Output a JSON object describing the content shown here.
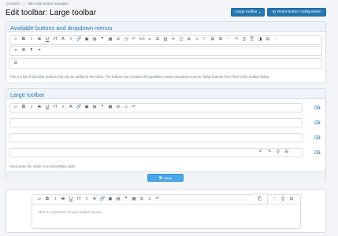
{
  "breadcrumb": {
    "items": [
      "Connect",
      "BB code button manager"
    ],
    "separator": ">"
  },
  "page": {
    "title": "Edit toolbar: Large toolbar"
  },
  "header_buttons": {
    "large_toolbar": "Large toolbar",
    "reset": "Reset button configuration"
  },
  "available": {
    "title": "Available buttons and dropdown menus",
    "row1_icons": [
      "smile-icon",
      "bold-icon",
      "italic-icon",
      "strikethrough-icon",
      "underline-icon",
      "font-size-icon",
      "color-icon",
      "text-style-icon",
      "link-icon",
      "image-icon",
      "media-icon",
      "quote-icon",
      "spoiler-icon",
      "emoji-icon",
      "undo-icon",
      "redo-icon",
      "code-icon",
      "align-icon",
      "list-icon",
      "table-icon",
      "inline-code-icon",
      "hide-icon",
      "more-icon"
    ],
    "row1_glyphs": [
      "☺",
      "B",
      "I",
      "S",
      "U",
      "тT",
      "A",
      "◊",
      "🔗",
      "▣",
      "▤",
      "❞",
      "▦",
      "⊘",
      "◷",
      "↶",
      "</>",
      "≡",
      "☰",
      "▥",
      "⌗",
      "◫",
      "⊕",
      "☺",
      "⚐",
      "⊞",
      "≣",
      "⋯",
      "↷",
      "{}",
      "⎘",
      "◨",
      "⊟",
      "⋮"
    ],
    "row2_glyphs": [
      "≡",
      "≣",
      "¶",
      "⚭"
    ],
    "row3_glyphs": [
      "☰"
    ],
    "note": "This is a list of all editor buttons that can be added to the editor. The bottom row contains the available custom dropdown menus. Move buttons from here to the toolbar below."
  },
  "large": {
    "title": "Large toolbar",
    "row1_glyphs": [
      "☺",
      "B",
      "I",
      "S",
      "U",
      "тT",
      "◊",
      "A",
      "🔗",
      "▣",
      "▤",
      "❞",
      "▦",
      "⊘",
      "☺",
      "↶"
    ],
    "row4_right_glyphs": [
      "↶",
      "↷",
      "{}",
      "⊟"
    ],
    "note": "Used when the editor is at least 900px wide.",
    "save_label": "Save"
  },
  "preview": {
    "toolbar_glyphs": [
      "☺",
      "B",
      "I",
      "S",
      "U",
      "тT",
      "◊",
      "A",
      "🔗",
      "▣",
      "▤",
      "❞",
      "▦",
      "⊘",
      "☺",
      "↶"
    ],
    "right_glyphs": [
      "↶",
      "↷",
      "{}",
      "⊟"
    ],
    "side_glyph": "⎗",
    "placeholder": "This is a preview of your button layout..."
  },
  "colors": {
    "accent": "#2577b1",
    "save": "#47a7eb",
    "header_bg": "#eef3fa"
  }
}
